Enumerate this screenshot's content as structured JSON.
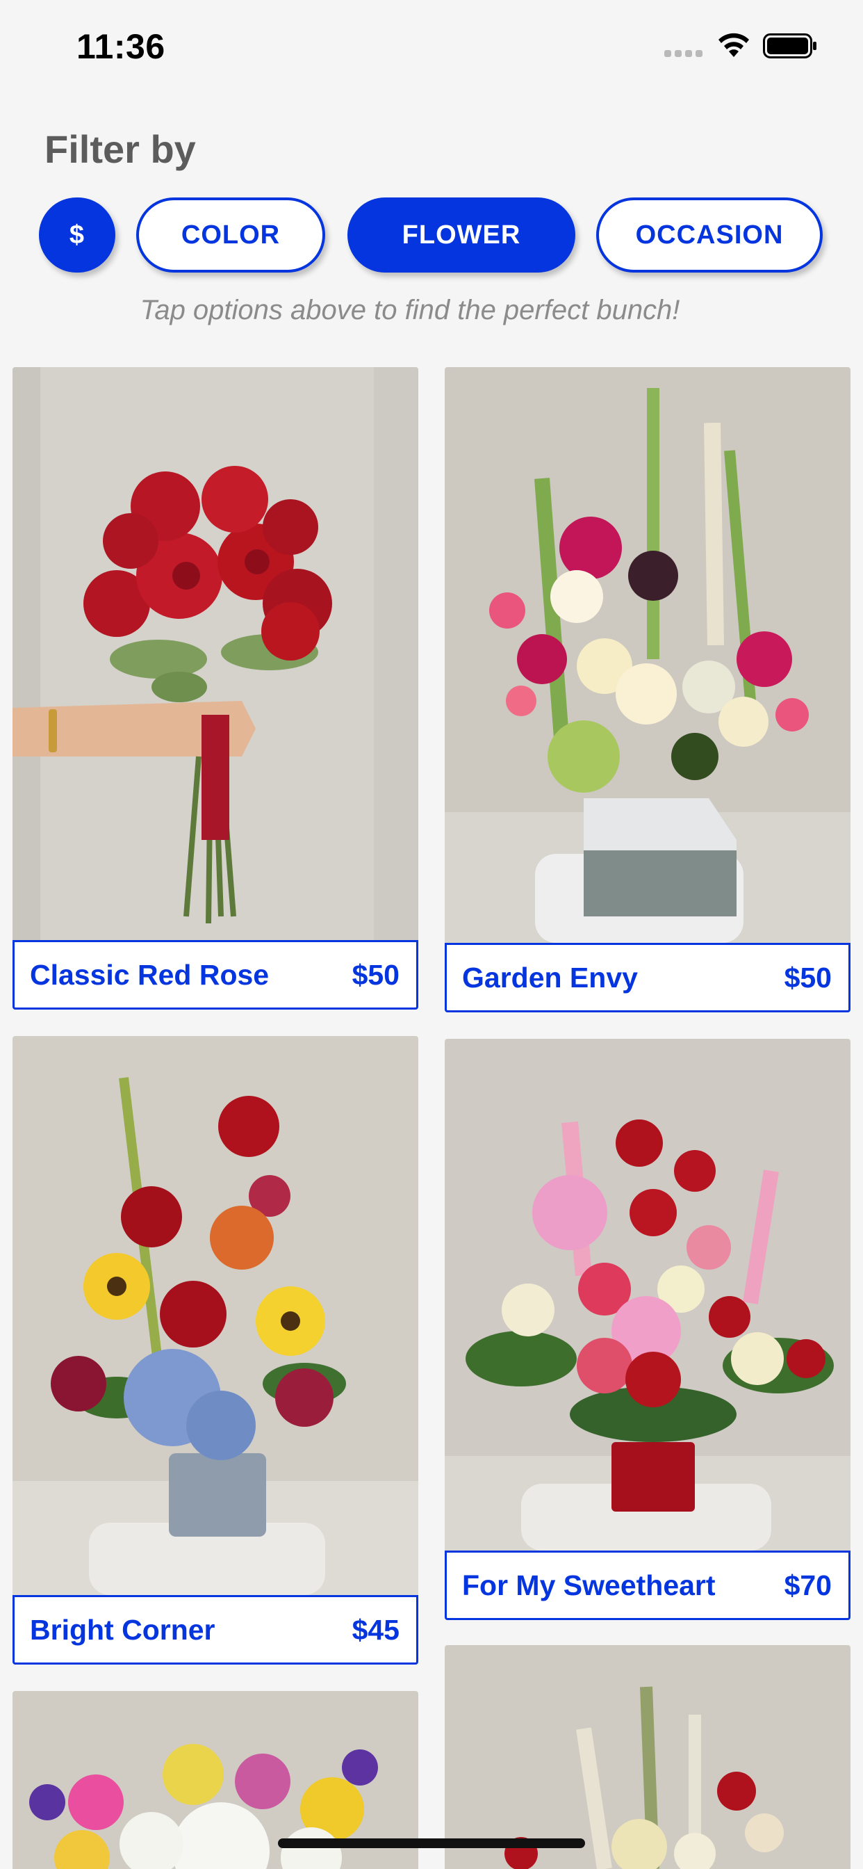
{
  "status_bar": {
    "time": "11:36",
    "icons": [
      "cellular-signal-icon",
      "wifi-icon",
      "battery-icon"
    ]
  },
  "filter": {
    "title": "Filter by",
    "chips": [
      {
        "label": "$",
        "active": true
      },
      {
        "label": "COLOR",
        "active": false
      },
      {
        "label": "FLOWER",
        "active": true
      },
      {
        "label": "OCCASION",
        "active": false
      }
    ],
    "hint": "Tap options above to find the perfect bunch!"
  },
  "products": [
    {
      "name": "Classic Red Rose",
      "price": "$50"
    },
    {
      "name": "Garden Envy",
      "price": "$50"
    },
    {
      "name": "Bright Corner",
      "price": "$45"
    },
    {
      "name": "For My Sweetheart",
      "price": "$70"
    }
  ],
  "colors": {
    "accent": "#0535de",
    "background": "#f5f5f5",
    "title_gray": "#5c5c5c",
    "hint_gray": "#8b8b8b"
  }
}
